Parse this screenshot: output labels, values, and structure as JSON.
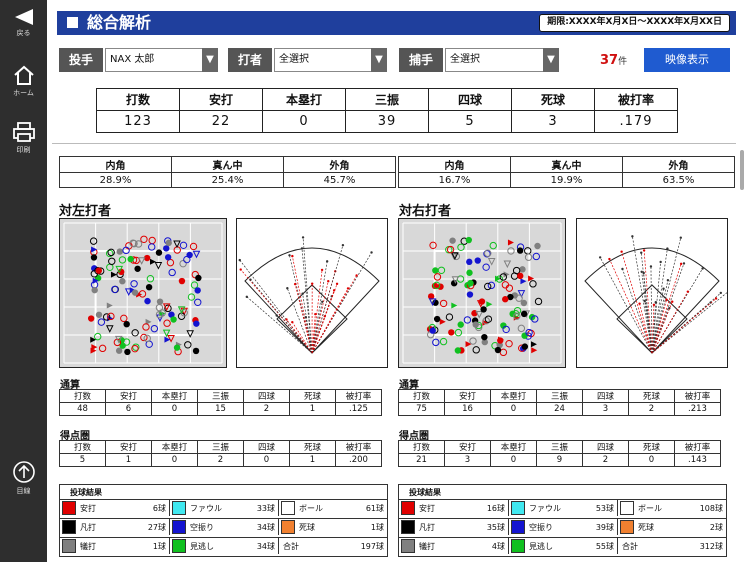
{
  "sidebar": {
    "back_label": "戻る",
    "home_label": "ホーム",
    "print_label": "印刷",
    "menu_label": "目線"
  },
  "header": {
    "title": "総合解析",
    "period": "期限:XXXX年X月X日〜XXXX年X月XX日"
  },
  "filters": {
    "pitcher_label": "投手",
    "pitcher_value": "NAX 太郎",
    "batter_label": "打者",
    "batter_value": "全選択",
    "catcher_label": "捕手",
    "catcher_value": "全選択"
  },
  "count": {
    "value": "37",
    "unit": "件"
  },
  "video_button": "映像表示",
  "stats": {
    "headers": [
      "打数",
      "安打",
      "本塁打",
      "三振",
      "四球",
      "死球",
      "被打率"
    ],
    "values": [
      "123",
      "22",
      "0",
      "39",
      "5",
      "3",
      ".179"
    ]
  },
  "left": {
    "zone": {
      "headers": [
        "内角",
        "真ん中",
        "外角"
      ],
      "values": [
        "28.9%",
        "25.4%",
        "45.7%"
      ]
    },
    "title": "対左打者",
    "total": {
      "label": "通算",
      "headers": [
        "打数",
        "安打",
        "本塁打",
        "三振",
        "四球",
        "死球",
        "被打率"
      ],
      "values": [
        "48",
        "6",
        "0",
        "15",
        "2",
        "1",
        ".125"
      ]
    },
    "risp": {
      "label": "得点圏",
      "headers": [
        "打数",
        "安打",
        "本塁打",
        "三振",
        "四球",
        "死球",
        "被打率"
      ],
      "values": [
        "5",
        "1",
        "0",
        "2",
        "0",
        "1",
        ".200"
      ]
    },
    "legend": {
      "title": "投球結果",
      "items": [
        {
          "name": "安打",
          "value": "6球",
          "color": "#e00000"
        },
        {
          "name": "ファウル",
          "value": "33球",
          "color": "#40e8f0"
        },
        {
          "name": "ボール",
          "value": "61球",
          "color": "#ffffff"
        },
        {
          "name": "凡打",
          "value": "27球",
          "color": "#000000"
        },
        {
          "name": "空振り",
          "value": "34球",
          "color": "#1414d0"
        },
        {
          "name": "死球",
          "value": "1球",
          "color": "#f08030"
        },
        {
          "name": "犠打",
          "value": "1球",
          "color": "#808080"
        },
        {
          "name": "見逃し",
          "value": "34球",
          "color": "#10c020"
        },
        {
          "name": "合計",
          "value": "197球",
          "color": ""
        }
      ]
    }
  },
  "right": {
    "zone": {
      "headers": [
        "内角",
        "真ん中",
        "外角"
      ],
      "values": [
        "16.7%",
        "19.9%",
        "63.5%"
      ]
    },
    "title": "対右打者",
    "total": {
      "label": "通算",
      "headers": [
        "打数",
        "安打",
        "本塁打",
        "三振",
        "四球",
        "死球",
        "被打率"
      ],
      "values": [
        "75",
        "16",
        "0",
        "24",
        "3",
        "2",
        ".213"
      ]
    },
    "risp": {
      "label": "得点圏",
      "headers": [
        "打数",
        "安打",
        "本塁打",
        "三振",
        "四球",
        "死球",
        "被打率"
      ],
      "values": [
        "21",
        "3",
        "0",
        "9",
        "2",
        "0",
        ".143"
      ]
    },
    "legend": {
      "title": "投球結果",
      "items": [
        {
          "name": "安打",
          "value": "16球",
          "color": "#e00000"
        },
        {
          "name": "ファウル",
          "value": "53球",
          "color": "#40e8f0"
        },
        {
          "name": "ボール",
          "value": "108球",
          "color": "#ffffff"
        },
        {
          "name": "凡打",
          "value": "35球",
          "color": "#000000"
        },
        {
          "name": "空振り",
          "value": "39球",
          "color": "#1414d0"
        },
        {
          "name": "死球",
          "value": "2球",
          "color": "#f08030"
        },
        {
          "name": "犠打",
          "value": "4球",
          "color": "#808080"
        },
        {
          "name": "見逃し",
          "value": "55球",
          "color": "#10c020"
        },
        {
          "name": "合計",
          "value": "312球",
          "color": ""
        }
      ]
    }
  },
  "colors": {
    "header_bg": "#1f3f9d",
    "video_button": "#1f5bd0",
    "count": "#d01010",
    "sidebar": "#2e2e2e"
  },
  "icons": [
    "back-arrow-icon",
    "home-icon",
    "print-icon",
    "menu-circle-icon",
    "dropdown-arrow-icon"
  ]
}
